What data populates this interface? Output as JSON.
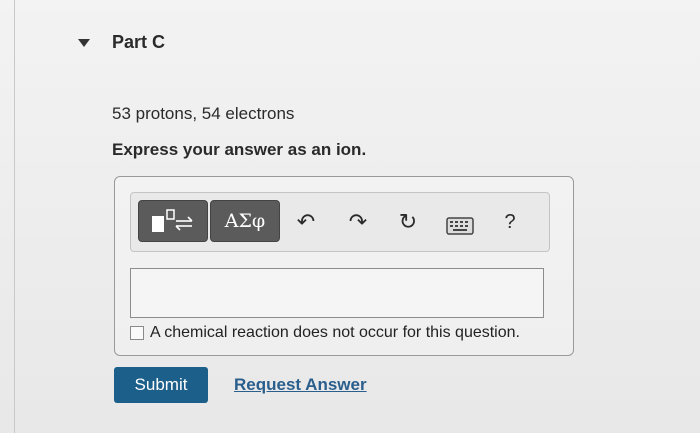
{
  "part": {
    "title": "Part C"
  },
  "question": {
    "text": "53 protons, 54 electrons",
    "instruction": "Express your answer as an ion."
  },
  "toolbar": {
    "greek_label": "ΑΣφ",
    "undo_glyph": "↶",
    "redo_glyph": "↷",
    "reset_glyph": "↻",
    "help_label": "?",
    "icons": [
      "template-icon",
      "greek-symbols-icon",
      "undo-icon",
      "redo-icon",
      "reset-icon",
      "keyboard-icon",
      "help-icon"
    ]
  },
  "answer": {
    "value": "",
    "placeholder": ""
  },
  "checkbox": {
    "label": "A chemical reaction does not occur for this question.",
    "checked": false
  },
  "actions": {
    "submit_label": "Submit",
    "request_answer_label": "Request Answer"
  },
  "colors": {
    "submit_bg": "#1b5f8a",
    "link": "#2a5e8c",
    "toolbar_button": "#5b5b5b"
  }
}
